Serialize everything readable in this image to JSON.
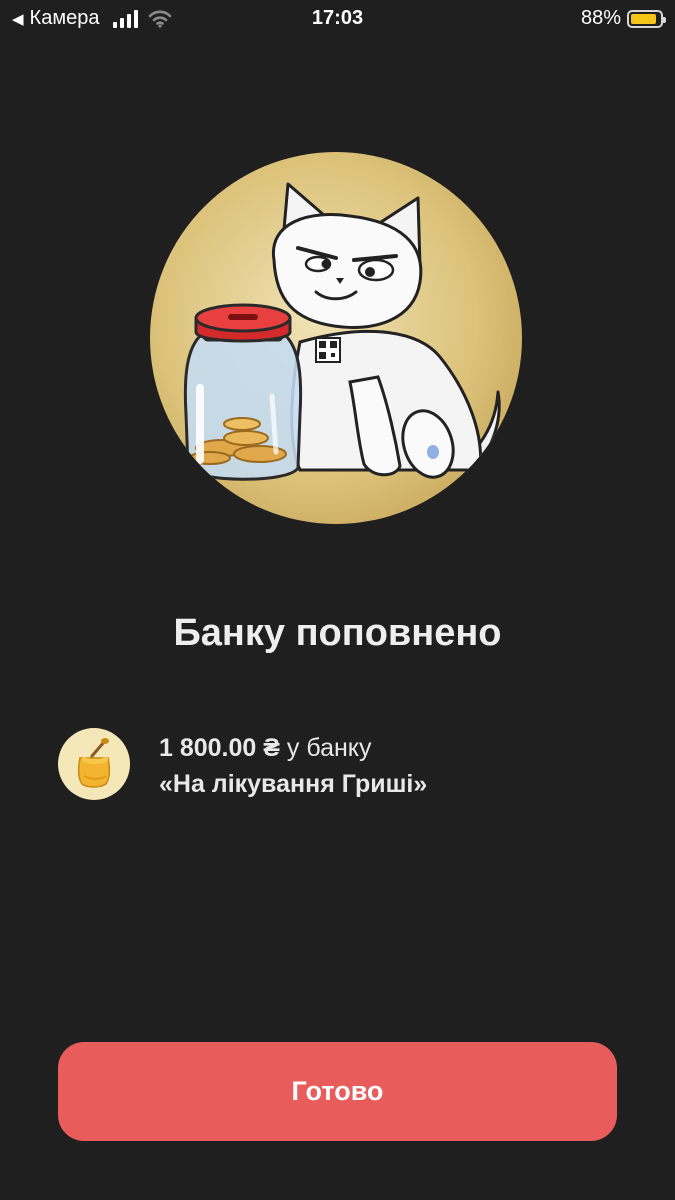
{
  "status_bar": {
    "back_label": "Камера",
    "time": "17:03",
    "battery_percent": "88%",
    "battery_level": 0.88,
    "battery_color": "#f5c518"
  },
  "hero": {
    "illustration": "cat-with-coin-jar",
    "background": "#dcc27a"
  },
  "title": "Банку поповнено",
  "detail": {
    "icon": "honey-jar-icon",
    "amount": "1 800.00 ₴",
    "suffix": " у банку",
    "jar_name": "«На лікування Гриші»"
  },
  "done_button": {
    "label": "Готово",
    "color": "#e85c5b"
  }
}
